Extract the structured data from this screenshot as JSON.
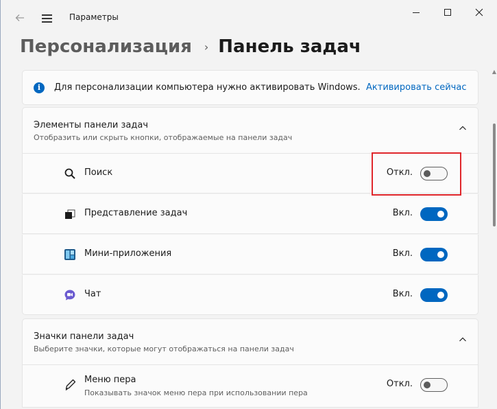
{
  "titlebar": {
    "title": "Параметры",
    "back_icon": "arrow-left-icon",
    "menu_icon": "hamburger-icon"
  },
  "breadcrumb": {
    "parent": "Персонализация",
    "separator": "›",
    "current": "Панель задач"
  },
  "banner": {
    "icon": "info-icon",
    "icon_glyph": "i",
    "text": "Для персонализации компьютера нужно активировать Windows.",
    "link": "Активировать сейчас"
  },
  "sections": [
    {
      "title": "Элементы панели задач",
      "subtitle": "Отобразить или скрыть кнопки, отображаемые на панели задач",
      "items": [
        {
          "label": "Поиск",
          "state": "Откл.",
          "on": false,
          "icon": "search-icon"
        },
        {
          "label": "Представление задач",
          "state": "Вкл.",
          "on": true,
          "icon": "task-view-icon"
        },
        {
          "label": "Мини-приложения",
          "state": "Вкл.",
          "on": true,
          "icon": "widgets-icon"
        },
        {
          "label": "Чат",
          "state": "Вкл.",
          "on": true,
          "icon": "chat-icon"
        }
      ]
    },
    {
      "title": "Значки панели задач",
      "subtitle": "Выберите значки, которые могут отображаться на панели задач",
      "items": [
        {
          "label": "Меню пера",
          "sub": "Показывать значок меню пера при использовании пера",
          "state": "Откл.",
          "on": false,
          "icon": "pen-icon"
        }
      ]
    }
  ],
  "colors": {
    "accent": "#0067c0",
    "highlight": "#e0262b"
  }
}
